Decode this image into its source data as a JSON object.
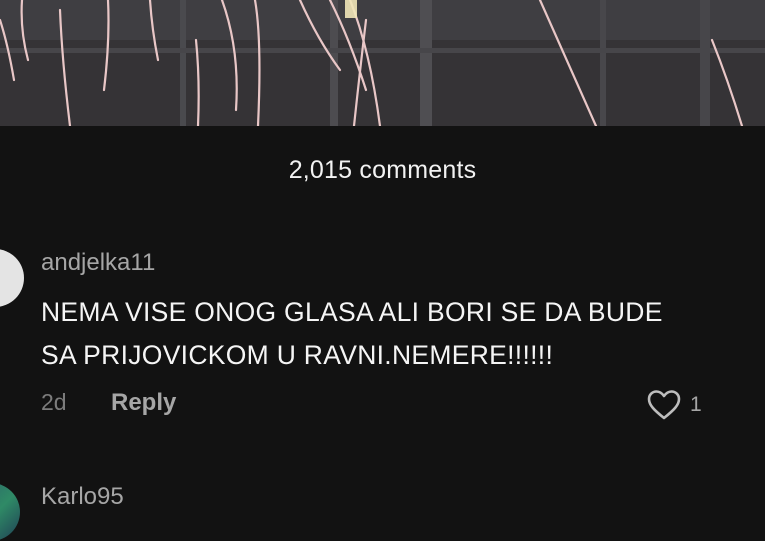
{
  "comments_panel": {
    "count_label": "2,015 comments"
  },
  "comments": [
    {
      "username": "andjelka11",
      "text_lines": [
        "NEMA VISE ONOG GLASA ALI BORI SE DA BUDE",
        "SA PRIJOVICKOM U RAVNI.NEMERE!!!!!!"
      ],
      "time": "2d",
      "reply_label": "Reply",
      "like_icon": "heart-outline-icon",
      "like_count": "1"
    },
    {
      "username": "Karlo95"
    }
  ],
  "colors": {
    "background": "#121212",
    "username": "#a6a6a6",
    "text": "#f5f5f5",
    "muted": "#7c7c7c"
  }
}
